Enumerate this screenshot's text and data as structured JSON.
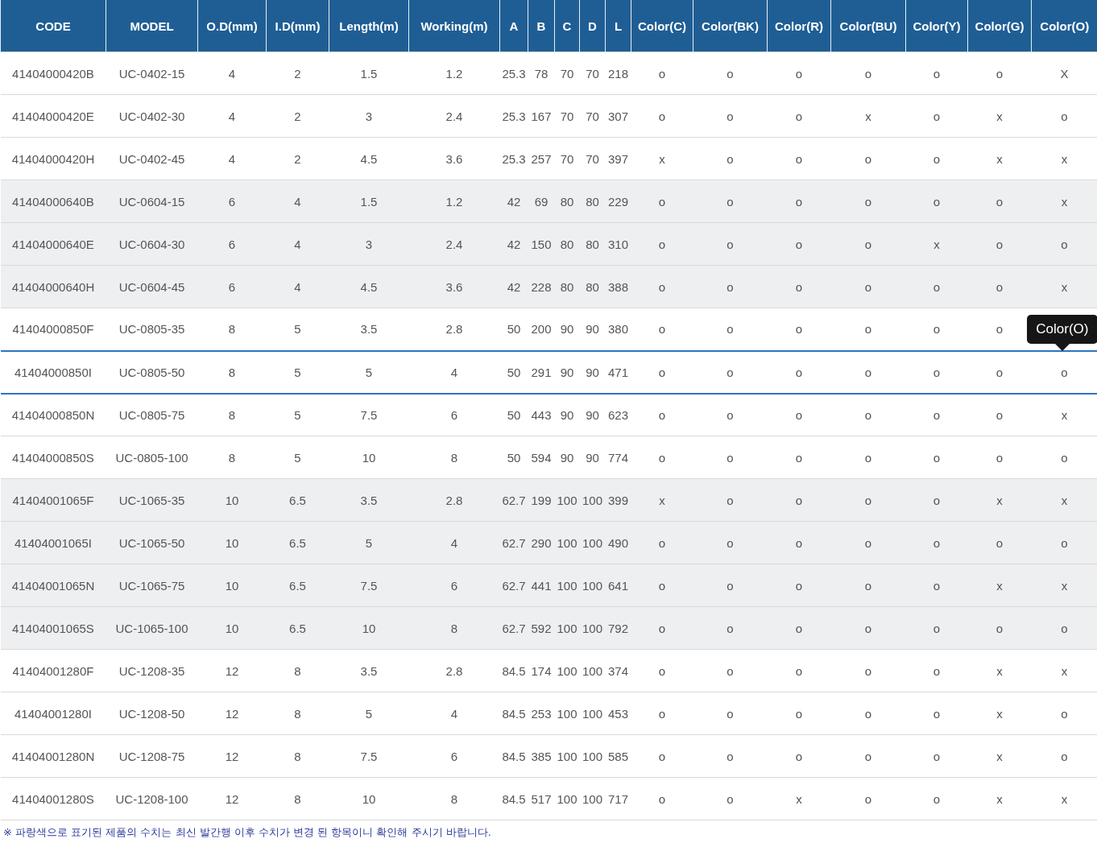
{
  "table": {
    "columns": [
      "CODE",
      "MODEL",
      "O.D(mm)",
      "I.D(mm)",
      "Length(m)",
      "Working(m)",
      "A",
      "B",
      "C",
      "D",
      "L",
      "Color(C)",
      "Color(BK)",
      "Color(R)",
      "Color(BU)",
      "Color(Y)",
      "Color(G)",
      "Color(O)"
    ],
    "rows": [
      {
        "shaded": false,
        "selected": false,
        "cells": [
          "41404000420B",
          "UC-0402-15",
          "4",
          "2",
          "1.5",
          "1.2",
          "25.3",
          "78",
          "70",
          "70",
          "218",
          "o",
          "o",
          "o",
          "o",
          "o",
          "o",
          "X"
        ]
      },
      {
        "shaded": false,
        "selected": false,
        "cells": [
          "41404000420E",
          "UC-0402-30",
          "4",
          "2",
          "3",
          "2.4",
          "25.3",
          "167",
          "70",
          "70",
          "307",
          "o",
          "o",
          "o",
          "x",
          "o",
          "x",
          "o"
        ]
      },
      {
        "shaded": false,
        "selected": false,
        "cells": [
          "41404000420H",
          "UC-0402-45",
          "4",
          "2",
          "4.5",
          "3.6",
          "25.3",
          "257",
          "70",
          "70",
          "397",
          "x",
          "o",
          "o",
          "o",
          "o",
          "x",
          "x"
        ]
      },
      {
        "shaded": true,
        "selected": false,
        "cells": [
          "41404000640B",
          "UC-0604-15",
          "6",
          "4",
          "1.5",
          "1.2",
          "42",
          "69",
          "80",
          "80",
          "229",
          "o",
          "o",
          "o",
          "o",
          "o",
          "o",
          "x"
        ]
      },
      {
        "shaded": true,
        "selected": false,
        "cells": [
          "41404000640E",
          "UC-0604-30",
          "6",
          "4",
          "3",
          "2.4",
          "42",
          "150",
          "80",
          "80",
          "310",
          "o",
          "o",
          "o",
          "o",
          "x",
          "o",
          "o"
        ]
      },
      {
        "shaded": true,
        "selected": false,
        "cells": [
          "41404000640H",
          "UC-0604-45",
          "6",
          "4",
          "4.5",
          "3.6",
          "42",
          "228",
          "80",
          "80",
          "388",
          "o",
          "o",
          "o",
          "o",
          "o",
          "o",
          "x"
        ]
      },
      {
        "shaded": false,
        "selected": false,
        "cells": [
          "41404000850F",
          "UC-0805-35",
          "8",
          "5",
          "3.5",
          "2.8",
          "50",
          "200",
          "90",
          "90",
          "380",
          "o",
          "o",
          "o",
          "o",
          "o",
          "o"
        ]
      },
      {
        "shaded": false,
        "selected": true,
        "cells": [
          "41404000850I",
          "UC-0805-50",
          "8",
          "5",
          "5",
          "4",
          "50",
          "291",
          "90",
          "90",
          "471",
          "o",
          "o",
          "o",
          "o",
          "o",
          "o",
          "o"
        ]
      },
      {
        "shaded": false,
        "selected": false,
        "cells": [
          "41404000850N",
          "UC-0805-75",
          "8",
          "5",
          "7.5",
          "6",
          "50",
          "443",
          "90",
          "90",
          "623",
          "o",
          "o",
          "o",
          "o",
          "o",
          "o",
          "x"
        ]
      },
      {
        "shaded": false,
        "selected": false,
        "cells": [
          "41404000850S",
          "UC-0805-100",
          "8",
          "5",
          "10",
          "8",
          "50",
          "594",
          "90",
          "90",
          "774",
          "o",
          "o",
          "o",
          "o",
          "o",
          "o",
          "o"
        ]
      },
      {
        "shaded": true,
        "selected": false,
        "cells": [
          "41404001065F",
          "UC-1065-35",
          "10",
          "6.5",
          "3.5",
          "2.8",
          "62.7",
          "199",
          "100",
          "100",
          "399",
          "x",
          "o",
          "o",
          "o",
          "o",
          "x",
          "x"
        ]
      },
      {
        "shaded": true,
        "selected": false,
        "cells": [
          "41404001065I",
          "UC-1065-50",
          "10",
          "6.5",
          "5",
          "4",
          "62.7",
          "290",
          "100",
          "100",
          "490",
          "o",
          "o",
          "o",
          "o",
          "o",
          "o",
          "o"
        ]
      },
      {
        "shaded": true,
        "selected": false,
        "cells": [
          "41404001065N",
          "UC-1065-75",
          "10",
          "6.5",
          "7.5",
          "6",
          "62.7",
          "441",
          "100",
          "100",
          "641",
          "o",
          "o",
          "o",
          "o",
          "o",
          "x",
          "x"
        ]
      },
      {
        "shaded": true,
        "selected": false,
        "cells": [
          "41404001065S",
          "UC-1065-100",
          "10",
          "6.5",
          "10",
          "8",
          "62.7",
          "592",
          "100",
          "100",
          "792",
          "o",
          "o",
          "o",
          "o",
          "o",
          "o",
          "o"
        ]
      },
      {
        "shaded": false,
        "selected": false,
        "cells": [
          "41404001280F",
          "UC-1208-35",
          "12",
          "8",
          "3.5",
          "2.8",
          "84.5",
          "174",
          "100",
          "100",
          "374",
          "o",
          "o",
          "o",
          "o",
          "o",
          "x",
          "x"
        ]
      },
      {
        "shaded": false,
        "selected": false,
        "cells": [
          "41404001280I",
          "UC-1208-50",
          "12",
          "8",
          "5",
          "4",
          "84.5",
          "253",
          "100",
          "100",
          "453",
          "o",
          "o",
          "o",
          "o",
          "o",
          "x",
          "o"
        ]
      },
      {
        "shaded": false,
        "selected": false,
        "cells": [
          "41404001280N",
          "UC-1208-75",
          "12",
          "8",
          "7.5",
          "6",
          "84.5",
          "385",
          "100",
          "100",
          "585",
          "o",
          "o",
          "o",
          "o",
          "o",
          "x",
          "o"
        ]
      },
      {
        "shaded": false,
        "selected": false,
        "cells": [
          "41404001280S",
          "UC-1208-100",
          "12",
          "8",
          "10",
          "8",
          "84.5",
          "517",
          "100",
          "100",
          "717",
          "o",
          "o",
          "x",
          "o",
          "o",
          "x",
          "x"
        ]
      }
    ]
  },
  "tooltip": {
    "text": "Color(O)"
  },
  "footnote": "※ 파랑색으로 표기된 제품의 수치는 최신 발간행 이후 수치가 변경 된 항목이니 확인해 주시기 바랍니다."
}
